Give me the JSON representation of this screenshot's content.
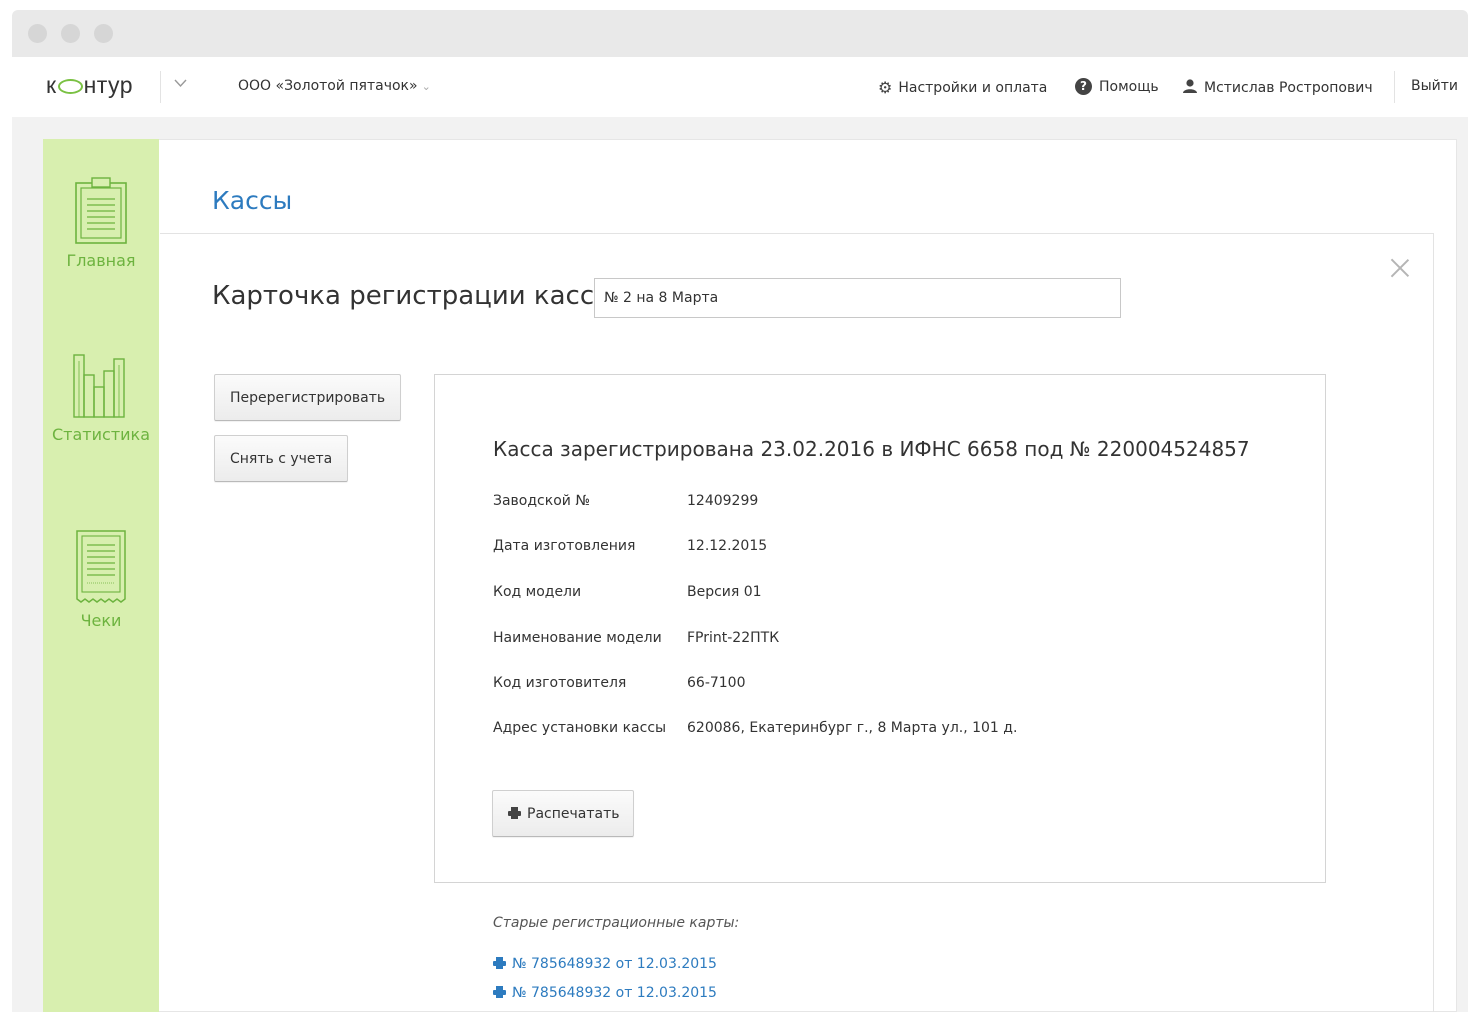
{
  "header": {
    "logo_prefix": "к",
    "logo_suffix": "нтур",
    "org_name": "ООО «Золотой пятачок»",
    "org_arrow": "⌄",
    "settings_label": "Настройки и оплата",
    "help_label": "Помощь",
    "user_name": "Мстислав Ростропович",
    "logout_label": "Выйти"
  },
  "sidebar": {
    "items": [
      {
        "label": "Главная",
        "icon": "clipboard-icon"
      },
      {
        "label": "Статистика",
        "icon": "bar-chart-icon"
      },
      {
        "label": "Чеки",
        "icon": "receipt-icon"
      }
    ],
    "accent_color": "#6db33f",
    "bg_color": "#d8efaf"
  },
  "page": {
    "title": "Кассы"
  },
  "card": {
    "title": "Карточка регистрации кассы",
    "name_value": "№ 2 на 8 Марта",
    "reregister_label": "Перерегистрировать",
    "deregister_label": "Снять с учета",
    "heading": "Касса зарегистрирована 23.02.2016 в ИФНС 6658 под № 220004524857",
    "fields": [
      {
        "label": "Заводской №",
        "value": "12409299"
      },
      {
        "label": "Дата изготовления",
        "value": "12.12.2015"
      },
      {
        "label": "Код модели",
        "value": "Версия 01"
      },
      {
        "label": "Наименование модели",
        "value": "FPrint-22ПТК"
      },
      {
        "label": "Код изготовителя",
        "value": "66-7100"
      },
      {
        "label": "Адрес установки кассы",
        "value": "620086, Екатеринбург г., 8 Марта ул., 101 д."
      }
    ],
    "print_label": "Распечатать"
  },
  "old_cards": {
    "title": "Старые регистрационные карты:",
    "links": [
      "№ 785648932 от 12.03.2015",
      "№ 785648932 от 12.03.2015"
    ]
  },
  "colors": {
    "link": "#2d7bbf",
    "logo_ring": "#7ac143"
  }
}
